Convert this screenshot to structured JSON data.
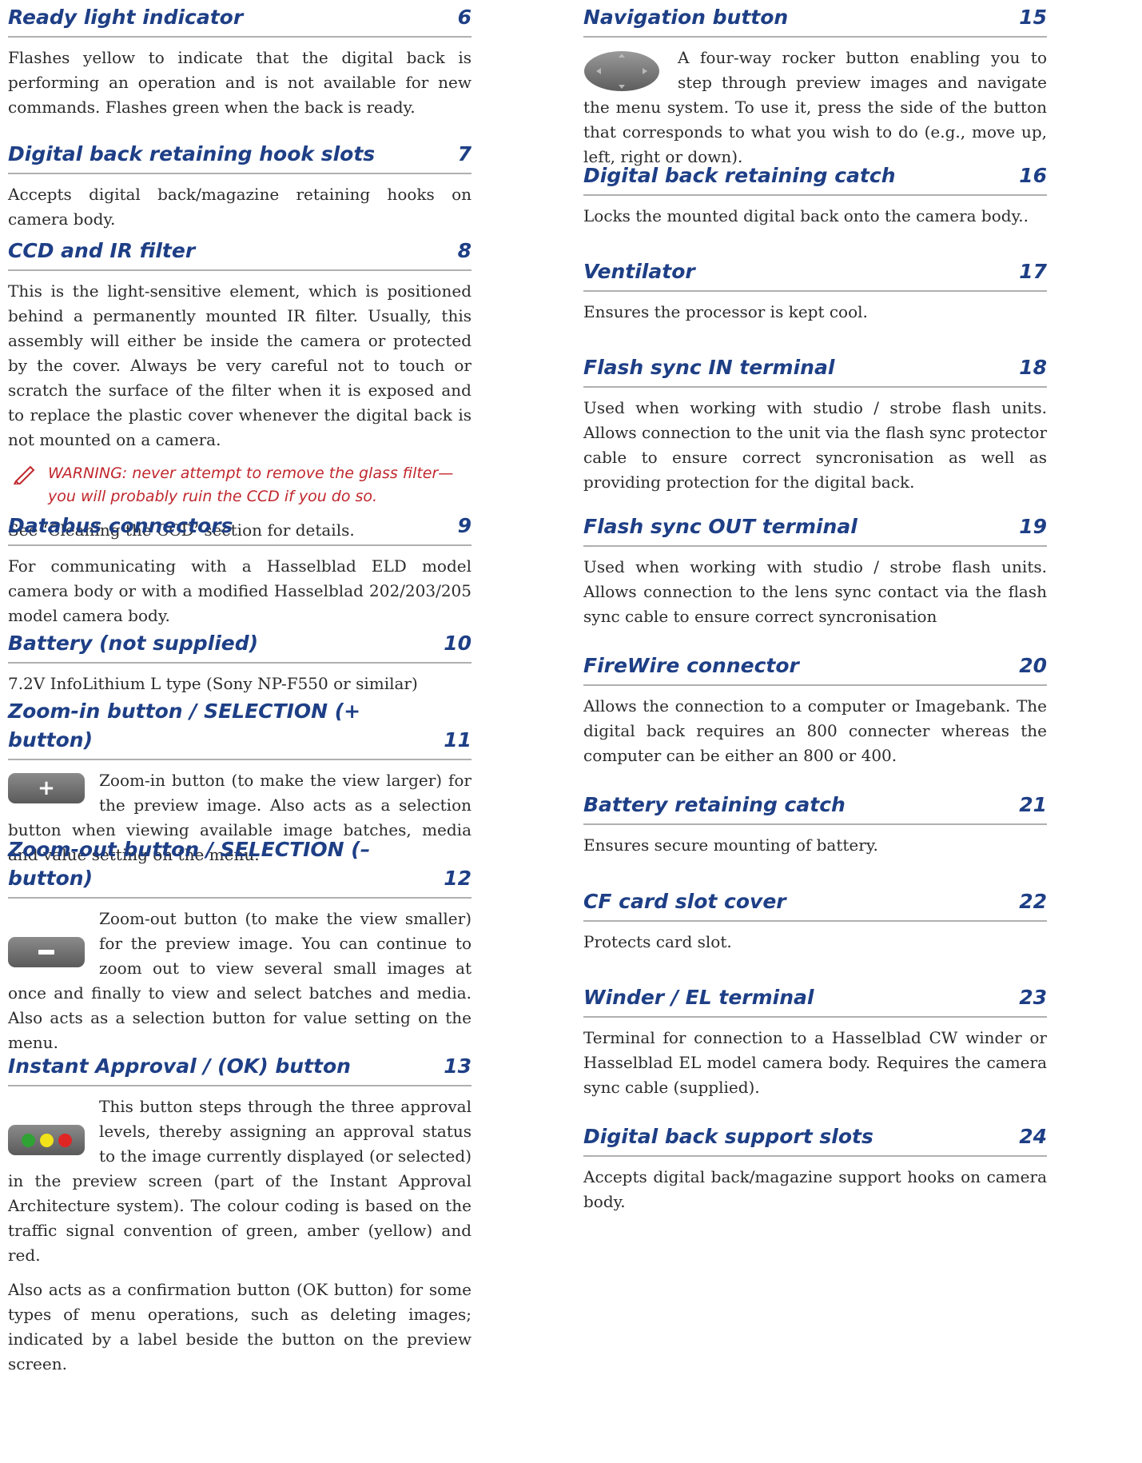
{
  "left": [
    {
      "title": "Ready light indicator",
      "num": "6",
      "p1": "Flashes yellow to indicate that the digital back is performing an operation and is not available for new commands. Flashes green when the back is ready."
    },
    {
      "title": "Digital back retaining hook slots",
      "num": "7",
      "p1": "Accepts digital back/magazine retaining hooks on camera body."
    },
    {
      "title": "CCD and IR filter",
      "num": "8",
      "p1": "This is the light-sensitive element, which is positioned behind a permanently mounted IR filter. Usually, this assembly will either be inside the camera or protected by the cover. Always be very careful not to touch or scratch the surface of the filter when it is exposed and to replace the plastic cover whenever the digital back is not mounted on a camera.",
      "warning": "WARNING: never attempt to remove the glass filter—you will probably ruin the CCD if you do so.",
      "p2": "See ‘Cleaning the CCD’ section for details."
    },
    {
      "title": "Databus connectors",
      "num": "9",
      "p1": "For communicating with a Hasselblad ELD model camera body or with a modified Hasselblad 202/203/205 model camera body."
    },
    {
      "title": "Battery  (not supplied)",
      "num": "10",
      "p1": "7.2V InfoLithium L type (Sony NP-F550 or similar)"
    },
    {
      "title": "Zoom-in button  / SELECTION (+ button)",
      "num": "11",
      "p1": "Zoom-in button (to make the view larger) for the preview image. Also acts as a selection button when viewing available image batches, media and value setting on the menu."
    },
    {
      "title": "Zoom-out button  / SELECTION (– button)",
      "num": "12",
      "p1": "Zoom-out button (to make the view smaller) for the preview image. You can continue to zoom out to view several small images at once and finally to view and select batches and media. Also acts as a selection button for value setting on the menu."
    },
    {
      "title": "Instant Approval / (OK) button",
      "num": "13",
      "p1": "This button steps through the three approval levels, thereby assigning an approval status to the image currently displayed (or selected) in the preview screen (part of the Instant Approval Architecture system). The colour coding is based on the traffic signal convention of green, amber (yellow) and red.",
      "p2": "Also acts as a confirmation button (OK button) for some types of menu operations, such as deleting images; indicated by a label beside the button on the preview screen."
    }
  ],
  "right": [
    {
      "title": "Navigation button",
      "num": "15",
      "p1": "A four-way rocker button enabling you to step through preview images and navigate the menu system. To use it, press the side of the button that corresponds to what you wish to do (e.g., move up, left, right or down)."
    },
    {
      "title": "Digital back retaining catch",
      "num": "16",
      "p1": "Locks the mounted digital back onto the camera body.."
    },
    {
      "title": "Ventilator",
      "num": "17",
      "p1": "Ensures the processor is kept cool."
    },
    {
      "title": "Flash sync IN terminal",
      "num": "18",
      "p1": "Used when working with studio / strobe flash units. Allows connection to the unit via the flash sync protector cable to ensure correct syncronisation as well as providing protection for the digital back."
    },
    {
      "title": "Flash sync OUT terminal",
      "num": "19",
      "p1": "Used when working with studio / strobe flash units. Allows connection to the lens sync contact via the flash sync cable to ensure correct syncronisation"
    },
    {
      "title": "FireWire connector",
      "num": "20",
      "p1": "Allows the connection to a computer or Imagebank. The digital back requires an 800 connecter whereas the computer can be either an 800 or 400."
    },
    {
      "title": "Battery retaining catch",
      "num": "21",
      "p1": "Ensures secure mounting of battery."
    },
    {
      "title": "CF card slot cover",
      "num": "22",
      "p1": "Protects card slot."
    },
    {
      "title": "Winder / EL terminal",
      "num": "23",
      "p1": "Terminal for connection to a Hasselblad CW winder or Hasselblad EL model camera body. Requires the camera sync cable (supplied)."
    },
    {
      "title": "Digital back support slots",
      "num": "24",
      "p1": "Accepts digital back/magazine support hooks on camera body."
    }
  ],
  "colors": {
    "heading": "#1e3f86",
    "warning": "#c0272d",
    "rule": "#b0b0b0",
    "green": "#2fa334",
    "yellow": "#f1e21a",
    "red": "#e02525"
  },
  "icons": [
    "plus-icon",
    "minus-icon",
    "traffic-light-icon",
    "navigation-rocker-icon",
    "pencil-icon"
  ]
}
